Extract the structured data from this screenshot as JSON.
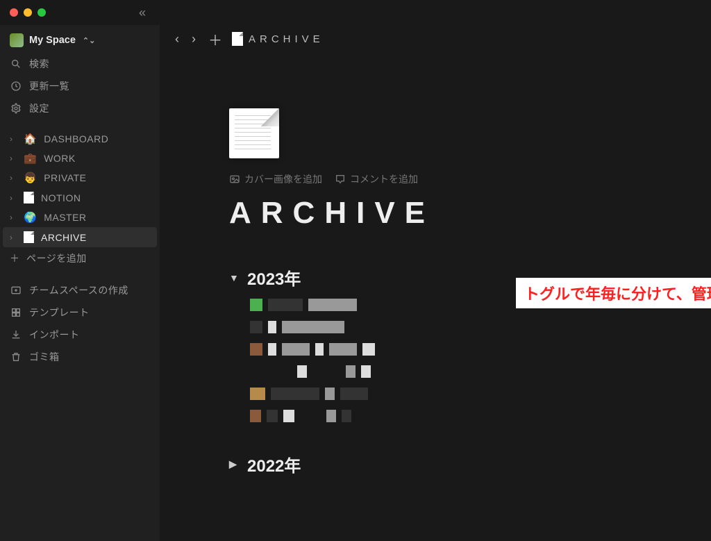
{
  "workspace": {
    "name": "My Space"
  },
  "sidebar": {
    "nav": [
      {
        "icon": "search-icon",
        "label": "検索"
      },
      {
        "icon": "clock-icon",
        "label": "更新一覧"
      },
      {
        "icon": "gear-icon",
        "label": "設定"
      }
    ],
    "pages": [
      {
        "emoji": "🏠",
        "label": "DASHBOARD"
      },
      {
        "emoji": "💼",
        "label": "WORK"
      },
      {
        "emoji": "👦",
        "label": "PRIVATE"
      },
      {
        "emoji": "doc",
        "label": "NOTION"
      },
      {
        "emoji": "🌍",
        "label": "MASTER"
      },
      {
        "emoji": "doc",
        "label": "ARCHIVE",
        "active": true
      }
    ],
    "add_page": "ページを追加",
    "footer": [
      {
        "icon": "teamspace-icon",
        "label": "チームスペースの作成"
      },
      {
        "icon": "template-icon",
        "label": "テンプレート"
      },
      {
        "icon": "import-icon",
        "label": "インポート"
      },
      {
        "icon": "trash-icon",
        "label": "ゴミ箱"
      }
    ]
  },
  "breadcrumb": {
    "title": "ARCHIVE"
  },
  "page": {
    "cover_action": "カバー画像を追加",
    "comment_action": "コメントを追加",
    "title": "ARCHIVE",
    "toggles": [
      {
        "label": "2023年",
        "open": true
      },
      {
        "label": "2022年",
        "open": false
      }
    ]
  },
  "annotation": "トグルで年毎に分けて、管理"
}
